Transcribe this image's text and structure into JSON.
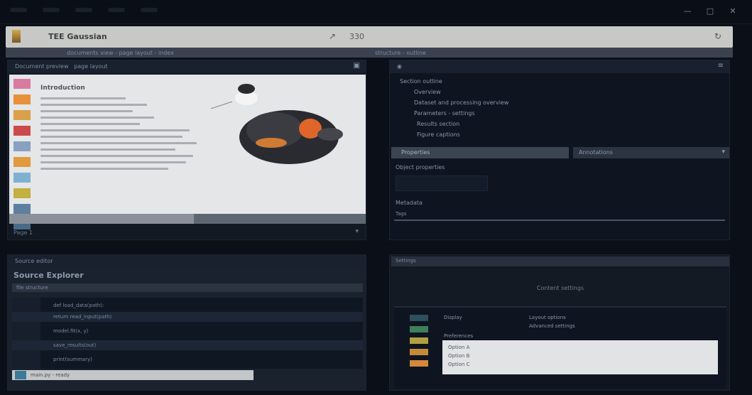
{
  "window": {
    "title": "TEE Gaussian",
    "nav_icon": "arrow-icon",
    "count": "330",
    "reload_icon": "reload-icon",
    "controls": [
      "—",
      "□",
      "✕"
    ],
    "strip_left": "documents view - page layout - index",
    "strip_right": "structure - outline"
  },
  "panes": {
    "top_left": {
      "header": "Document preview",
      "header_right": "page layout",
      "doc_title": "Introduction",
      "status": "Page 1",
      "status_right": "▾",
      "thumb_colors": [
        "#d97ba0",
        "#e8903a",
        "#d8a14a",
        "#cc4a4a",
        "#8aa0c2",
        "#e09b3c",
        "#7fb0d0",
        "#c2b040",
        "#5d7fa0",
        "#4a6a88"
      ]
    },
    "top_right": {
      "tree": [
        "Section outline",
        "Overview",
        "Dataset and processing overview",
        "Parameters - settings",
        "Results section",
        "Figure captions"
      ],
      "tab_a": "Properties",
      "tab_b": "Annotations",
      "field_label": "Object properties",
      "field2_label": "Metadata",
      "field3_label": "Tags"
    },
    "bottom_left": {
      "header": "Source editor",
      "title": "Source Explorer",
      "sub": "file structure",
      "code_lines": [
        "def load_data(path):",
        "return read_input(path)",
        "model.fit(x, y)",
        "save_results(out)",
        "print(summary)"
      ],
      "foot": "main.py - ready"
    },
    "bottom_right": {
      "header": "Settings",
      "title": "Content settings",
      "label1": "Display",
      "label2": "Layout options",
      "label3": "Advanced settings",
      "label4": "Preferences",
      "card": [
        "Option A",
        "Option B",
        "Option C"
      ],
      "icon_colors": [
        "#2f4e5e",
        "#3e7f5a",
        "#b0a040",
        "#c48a3a",
        "#d4883a"
      ]
    }
  }
}
